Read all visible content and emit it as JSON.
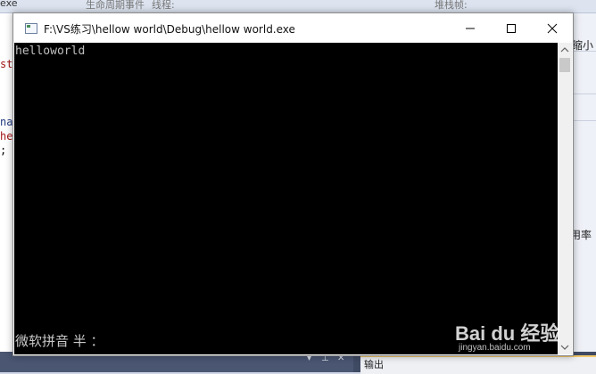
{
  "background_ide": {
    "toolbar": {
      "config_value": "exe",
      "event_label": "生命周期事件",
      "thread_label": "线程:",
      "stack_label": "堆栈帧:"
    },
    "editor_fragments": [
      "str",
      "nam",
      "he",
      ";"
    ],
    "right_panel": {
      "zoom_label": "缩小",
      "usage_label": "用率"
    },
    "output_tab_label": "输出"
  },
  "window": {
    "title": "F:\\VS练习\\hellow world\\Debug\\hellow world.exe",
    "controls": {
      "minimize": "minimize-icon",
      "maximize": "maximize-icon",
      "close": "close-icon"
    }
  },
  "console": {
    "output_line": "helloworld",
    "ime_status": "微软拼音 半 ："
  },
  "watermark": {
    "brand": "Bai du 经验",
    "url": "jingyan.baidu.com"
  },
  "colors": {
    "console_bg": "#000000",
    "console_text": "#c0c0c0",
    "titlebar_bg": "#ffffff",
    "ide_bg": "#cfd6e5"
  }
}
